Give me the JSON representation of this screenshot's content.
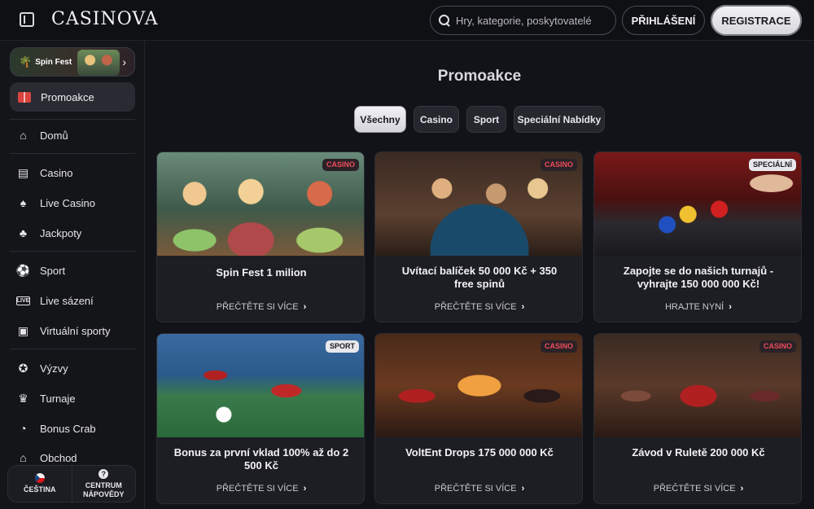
{
  "header": {
    "logo": "CASINOVA",
    "search_placeholder": "Hry, kategorie, poskytovatelé",
    "login_label": "PŘIHLÁŠENÍ",
    "register_label": "REGISTRACE"
  },
  "sidebar": {
    "spinfest_label": "Spin Fest",
    "promo_label": "Promoakce",
    "items": [
      {
        "label": "Domů",
        "icon": "home-icon"
      },
      {
        "label": "Casino",
        "icon": "slot-machine-icon"
      },
      {
        "label": "Live Casino",
        "icon": "live-dealer-icon"
      },
      {
        "label": "Jackpoty",
        "icon": "clover-icon"
      },
      {
        "label": "Sport",
        "icon": "soccer-ball-icon"
      },
      {
        "label": "Live sázení",
        "icon": "live-badge-icon"
      },
      {
        "label": "Virtuální sporty",
        "icon": "virtual-sports-icon"
      },
      {
        "label": "Výzvy",
        "icon": "challenge-icon"
      },
      {
        "label": "Turnaje",
        "icon": "trophy-icon"
      },
      {
        "label": "Bonus Crab",
        "icon": "claw-icon"
      },
      {
        "label": "Obchod",
        "icon": "shop-icon"
      }
    ],
    "language_label": "ČEŠTINA",
    "help_label_1": "CENTRUM",
    "help_label_2": "NÁPOVĚDY"
  },
  "main": {
    "title": "Promoakce",
    "filters": [
      "Všechny",
      "Casino",
      "Sport",
      "Speciální Nabídky"
    ],
    "active_filter": "Všechny",
    "cards": [
      {
        "badge": "CASINO",
        "title": "Spin Fest 1 milion",
        "link": "PŘEČTĚTE SI VÍCE"
      },
      {
        "badge": "CASINO",
        "title": "Uvítací balíček 50 000 Kč + 350 free spinů",
        "link": "PŘEČTĚTE SI VÍCE"
      },
      {
        "badge": "SPECIÁLNÍ",
        "title": "Zapojte se do našich turnajů - vyhrajte 150 000 000 Kč!",
        "link": "HRAJTE NYNÍ"
      },
      {
        "badge": "SPORT",
        "title": "Bonus za první vklad 100% až do 2 500 Kč",
        "link": "PŘEČTĚTE SI VÍCE"
      },
      {
        "badge": "CASINO",
        "title": "VoltEnt Drops 175 000 000 Kč",
        "link": "PŘEČTĚTE SI VÍCE"
      },
      {
        "badge": "CASINO",
        "title": "Závod v Ruletě 200 000 Kč",
        "link": "PŘEČTĚTE SI VÍCE"
      }
    ]
  }
}
